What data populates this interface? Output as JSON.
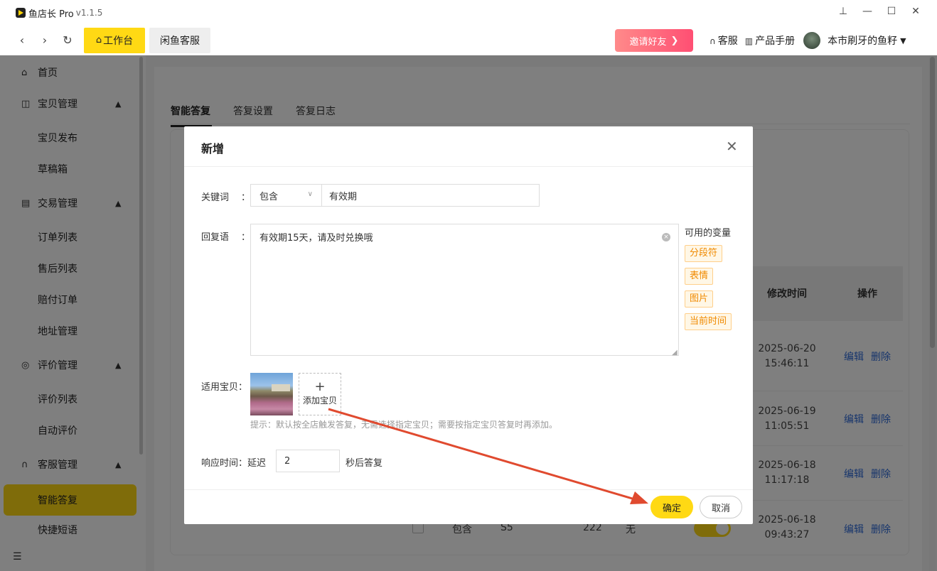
{
  "app": {
    "title": "鱼店长 Pro",
    "version": "v1.1.5"
  },
  "window_controls": [
    "pin-icon",
    "minimize-icon",
    "maximize-icon",
    "close-icon"
  ],
  "toolbar": {
    "home_tab": "工作台",
    "xianyu_tab": "闲鱼客服",
    "invite": "邀请好友",
    "service": "客服",
    "manual": "产品手册",
    "username": "本市刷牙的鱼籽"
  },
  "sidebar": {
    "items": [
      {
        "label": "首页",
        "icon": "home-icon"
      },
      {
        "label": "宝贝管理",
        "icon": "bag-icon"
      },
      {
        "label": "宝贝发布"
      },
      {
        "label": "草稿箱"
      },
      {
        "label": "交易管理",
        "icon": "doc-icon"
      },
      {
        "label": "订单列表"
      },
      {
        "label": "售后列表"
      },
      {
        "label": "赔付订单"
      },
      {
        "label": "地址管理"
      },
      {
        "label": "评价管理",
        "icon": "star-icon"
      },
      {
        "label": "评价列表"
      },
      {
        "label": "自动评价"
      },
      {
        "label": "客服管理",
        "icon": "headset-icon"
      },
      {
        "label": "智能答复"
      },
      {
        "label": "快捷短语"
      }
    ]
  },
  "main": {
    "tabs": [
      "智能答复",
      "答复设置",
      "答复日志"
    ],
    "table": {
      "headers": {
        "modified": "修改时间",
        "actions": "操作"
      },
      "rows": [
        {
          "date": "2025-06-20",
          "time": "15:46:11"
        },
        {
          "date": "2025-06-19",
          "time": "11:05:51"
        },
        {
          "date": "2025-06-18",
          "time": "11:17:18"
        },
        {
          "date": "2025-06-18",
          "time": "09:43:27"
        }
      ],
      "edit": "编辑",
      "delete": "删除",
      "last_row": {
        "match": "包含",
        "keyword": "S5",
        "count": "222",
        "goods": "无",
        "toggle": "启"
      }
    }
  },
  "dialog": {
    "title": "新增",
    "keyword_label": "关键词",
    "colon": "：",
    "match_mode": "包含",
    "keyword_value": "有效期",
    "reply_label": "回复语",
    "reply_value": "有效期15天，请及时兑换哦",
    "vars_title": "可用的变量",
    "vars": [
      "分段符",
      "表情",
      "图片",
      "当前时间"
    ],
    "goods_label": "适用宝贝：",
    "add_goods": "添加宝贝",
    "hint": "提示：默认按全店触发答复，无需选择指定宝贝；需要按指定宝贝答复时再添加。",
    "response_label": "响应时间：延迟",
    "delay_value": "2",
    "delay_suffix": "秒后答复",
    "confirm": "确定",
    "cancel": "取消"
  },
  "colors": {
    "accent": "#ffd914",
    "link": "#2f6bd8",
    "annotation_arrow": "#e04a2f",
    "var_tag": "#f08a00"
  }
}
